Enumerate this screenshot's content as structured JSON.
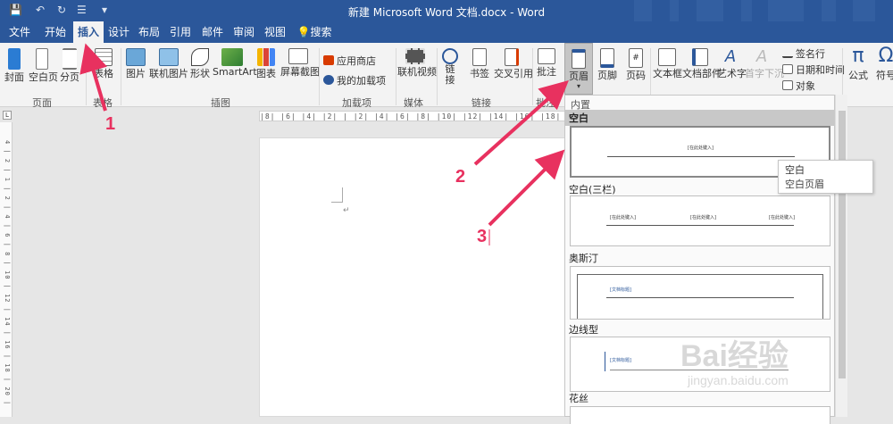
{
  "titlebar": {
    "doc_title": "新建 Microsoft Word 文档.docx  -  Word",
    "quick_access": [
      "save-icon",
      "undo-icon",
      "redo-icon",
      "bullets-icon",
      "customize-icon"
    ]
  },
  "tabs": [
    "文件",
    "开始",
    "插入",
    "设计",
    "布局",
    "引用",
    "邮件",
    "审阅",
    "视图",
    "搜索"
  ],
  "active_tab": "插入",
  "ribbon": {
    "pages": {
      "cover": "封面",
      "blank": "空白页",
      "break": "分页",
      "group": "页面"
    },
    "tables": {
      "table": "表格",
      "group": "表格"
    },
    "illustrations": {
      "pictures": "图片",
      "online_pictures": "联机图片",
      "shapes": "形状",
      "smartart": "SmartArt",
      "chart": "图表",
      "screenshot": "屏幕截图",
      "group": "插图"
    },
    "addins": {
      "store": "应用商店",
      "my_addins": "我的加载项",
      "group": "加载项"
    },
    "media": {
      "video": "联机视频",
      "group": "媒体"
    },
    "links": {
      "link": "链接",
      "bookmark": "书签",
      "crossref": "交叉引用",
      "group": "链接"
    },
    "comments": {
      "comment": "批注",
      "group": "批注"
    },
    "header_footer": {
      "header": "页眉",
      "footer": "页脚",
      "page_number": "页码"
    },
    "text": {
      "textbox": "文本框",
      "quickparts": "文档部件",
      "wordart": "艺术字",
      "dropcap": "首字下沉",
      "signature": "签名行",
      "datetime": "日期和时间",
      "object": "对象"
    },
    "symbols": {
      "equation": "公式",
      "symbol": "符号"
    }
  },
  "ruler_text": "|8| |6| |4| |2|  |  |2| |4| |6| |8| |10| |12| |14| |16| |18| |20| |22|",
  "vruler_text": "4 | 2 | 1 | 2 | 4 | 6 | 8 | 10 | 12 | 14 | 16 | 18 | 20 | 22",
  "corner_glyph": "L",
  "page": {
    "return_mark": "↵"
  },
  "gallery": {
    "section": "内置",
    "items": [
      {
        "name": "空白",
        "placeholder": "[在此处键入]"
      },
      {
        "name": "空白(三栏)",
        "placeholder": "[在此处键入]"
      },
      {
        "name": "奥斯汀",
        "placeholder": "[文档标题]"
      },
      {
        "name": "边线型",
        "placeholder": "[文档标题]"
      },
      {
        "name": "花丝",
        "placeholder": ""
      }
    ]
  },
  "tooltip": {
    "title": "空白",
    "desc": "空白页眉"
  },
  "annotations": [
    "1",
    "2",
    "3"
  ],
  "watermark": {
    "logo": "Bai经验",
    "url": "jingyan.baidu.com"
  },
  "colors": {
    "accent": "#2b579a",
    "annotation": "#e8315f",
    "active_tab_bg": "#f3f3f3"
  }
}
